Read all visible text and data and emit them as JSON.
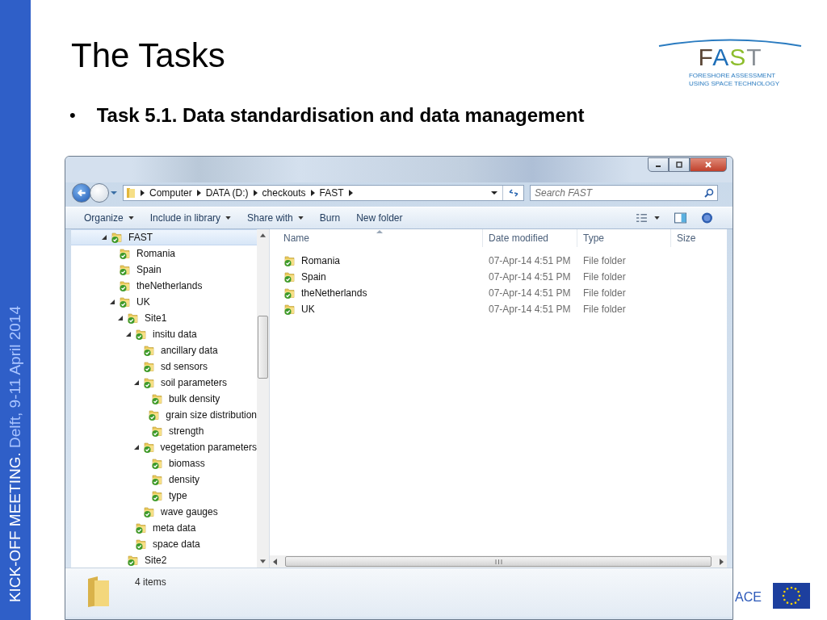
{
  "slide": {
    "sidebar_text_bold": "KICK-OFF MEETING.",
    "sidebar_text": "Delft, 9-11 April 2014",
    "title": "The Tasks",
    "logo": {
      "name": "FAST",
      "tagline_1": "FORESHORE ASSESSMENT",
      "tagline_2": "USING SPACE TECHNOLOGY"
    },
    "bullets": [
      {
        "marker": "•",
        "text": "Task 5.1. Data standardisation and data management"
      }
    ],
    "footer_text": "ACE"
  },
  "window": {
    "breadcrumb": [
      "Computer",
      "DATA (D:)",
      "checkouts",
      "FAST"
    ],
    "search": {
      "placeholder": "Search FAST"
    },
    "toolbar": [
      {
        "label": "Organize",
        "dropdown": true
      },
      {
        "label": "Include in library",
        "dropdown": true
      },
      {
        "label": "Share with",
        "dropdown": true
      },
      {
        "label": "Burn",
        "dropdown": false
      },
      {
        "label": "New folder",
        "dropdown": false
      }
    ],
    "navigation": [
      {
        "label": "FAST",
        "selected": true,
        "expanded": true,
        "children": [
          {
            "label": "Romania",
            "selected": false,
            "expanded": false
          },
          {
            "label": "Spain",
            "selected": false,
            "expanded": false
          },
          {
            "label": "theNetherlands",
            "selected": false,
            "expanded": false
          },
          {
            "label": "UK",
            "selected": false,
            "expanded": true,
            "children": [
              {
                "label": "Site1",
                "selected": false,
                "expanded": true,
                "children": [
                  {
                    "label": "insitu data",
                    "selected": false,
                    "expanded": true,
                    "children": [
                      {
                        "label": "ancillary data",
                        "selected": false,
                        "expanded": false
                      },
                      {
                        "label": "sd sensors",
                        "selected": false,
                        "expanded": false
                      },
                      {
                        "label": "soil parameters",
                        "selected": false,
                        "expanded": true,
                        "children": [
                          {
                            "label": "bulk density",
                            "selected": false,
                            "expanded": false
                          },
                          {
                            "label": "grain size distribution",
                            "selected": false,
                            "expanded": false
                          },
                          {
                            "label": "strength",
                            "selected": false,
                            "expanded": false
                          }
                        ]
                      },
                      {
                        "label": "vegetation parameters",
                        "selected": false,
                        "expanded": true,
                        "children": [
                          {
                            "label": "biomass",
                            "selected": false,
                            "expanded": false
                          },
                          {
                            "label": "density",
                            "selected": false,
                            "expanded": false
                          },
                          {
                            "label": "type",
                            "selected": false,
                            "expanded": false
                          }
                        ]
                      },
                      {
                        "label": "wave gauges",
                        "selected": false,
                        "expanded": false
                      }
                    ]
                  },
                  {
                    "label": "meta data",
                    "selected": false,
                    "expanded": false
                  },
                  {
                    "label": "space data",
                    "selected": false,
                    "expanded": false
                  }
                ]
              },
              {
                "label": "Site2",
                "selected": false,
                "expanded": false
              }
            ]
          }
        ]
      }
    ],
    "columns": [
      "Name",
      "Date modified",
      "Type",
      "Size"
    ],
    "files": [
      {
        "name": "Romania",
        "date": "07-Apr-14 4:51 PM",
        "type": "File folder"
      },
      {
        "name": "Spain",
        "date": "07-Apr-14 4:51 PM",
        "type": "File folder"
      },
      {
        "name": "theNetherlands",
        "date": "07-Apr-14 4:51 PM",
        "type": "File folder"
      },
      {
        "name": "UK",
        "date": "07-Apr-14 4:51 PM",
        "type": "File folder"
      }
    ],
    "status": "4 items"
  }
}
